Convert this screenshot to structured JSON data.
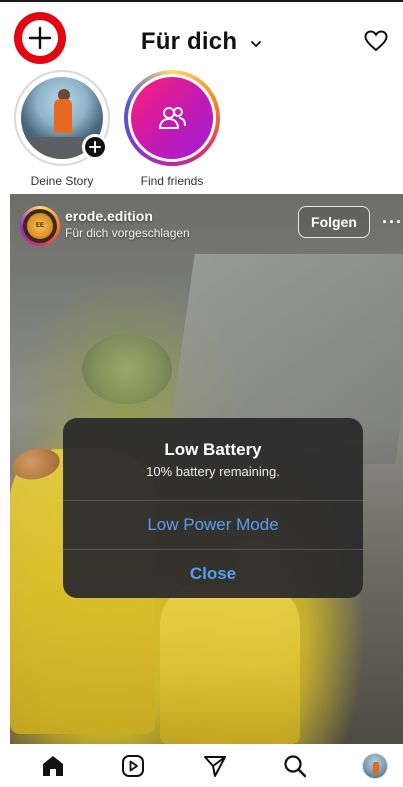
{
  "header": {
    "title": "Für dich"
  },
  "stories": [
    {
      "label": "Deine Story"
    },
    {
      "label": "Find friends"
    }
  ],
  "post": {
    "username": "erode.edition",
    "subtitle": "Für dich vorgeschlagen",
    "follow_label": "Folgen",
    "more_label": "···",
    "avatar_text": "ERODE EDITION"
  },
  "alert": {
    "title": "Low Battery",
    "message": "10% battery remaining.",
    "primary_action": "Low Power Mode",
    "close_action": "Close"
  },
  "colors": {
    "highlight_red": "#e30613",
    "alert_button_blue": "#5b9df0"
  },
  "icons": {
    "header": [
      "plus-icon",
      "chevron-down-icon",
      "heart-icon"
    ],
    "bottom_nav": [
      "home-icon",
      "reels-icon",
      "send-icon",
      "search-icon",
      "profile-avatar"
    ]
  }
}
